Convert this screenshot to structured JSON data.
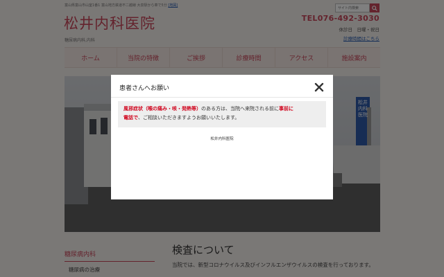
{
  "header": {
    "top_info": "富山県富山市山室1番1 富山地方鉄道不二越線 大泉駅から車で5分",
    "map_link": "[地図]",
    "site_title": "松井内科医院",
    "subtitle": "糖尿病内科,内科",
    "search_placeholder": "サイト内検索",
    "tel": "TEL076-492-3030",
    "holiday": "休診日　日曜・祝日",
    "hours_link": "診療時間はこちら"
  },
  "nav": {
    "items": [
      {
        "label": "ホーム"
      },
      {
        "label": "当院の特徴"
      },
      {
        "label": "ご挨拶"
      },
      {
        "label": "診療時間"
      },
      {
        "label": "アクセス"
      },
      {
        "label": "施設案内"
      }
    ]
  },
  "hero": {
    "sign_text": "松井内科医院"
  },
  "sidebar": {
    "heading": "糖尿病内科",
    "item": "糖尿病の治療"
  },
  "main": {
    "heading": "検査について",
    "text": "当院では、新型コロナウイルス及びインフルエンザウイルスの検査を行っております。"
  },
  "modal": {
    "title": "患者さんへお願い",
    "notice_red1": "風邪症状（喉の痛み・咳・発熱等）",
    "notice_text1": "のある方は、当院へ来院される前に",
    "notice_red2a": "事前に",
    "notice_red2b": "電話で",
    "notice_text2": "、ご相談いただきますようお願いいたします。",
    "signature": "松井内科医院"
  },
  "colors": {
    "accent": "#c8465a",
    "notice_red": "#d0021b",
    "link": "#2a5db0"
  },
  "icons": [
    "search-icon",
    "close-icon"
  ]
}
